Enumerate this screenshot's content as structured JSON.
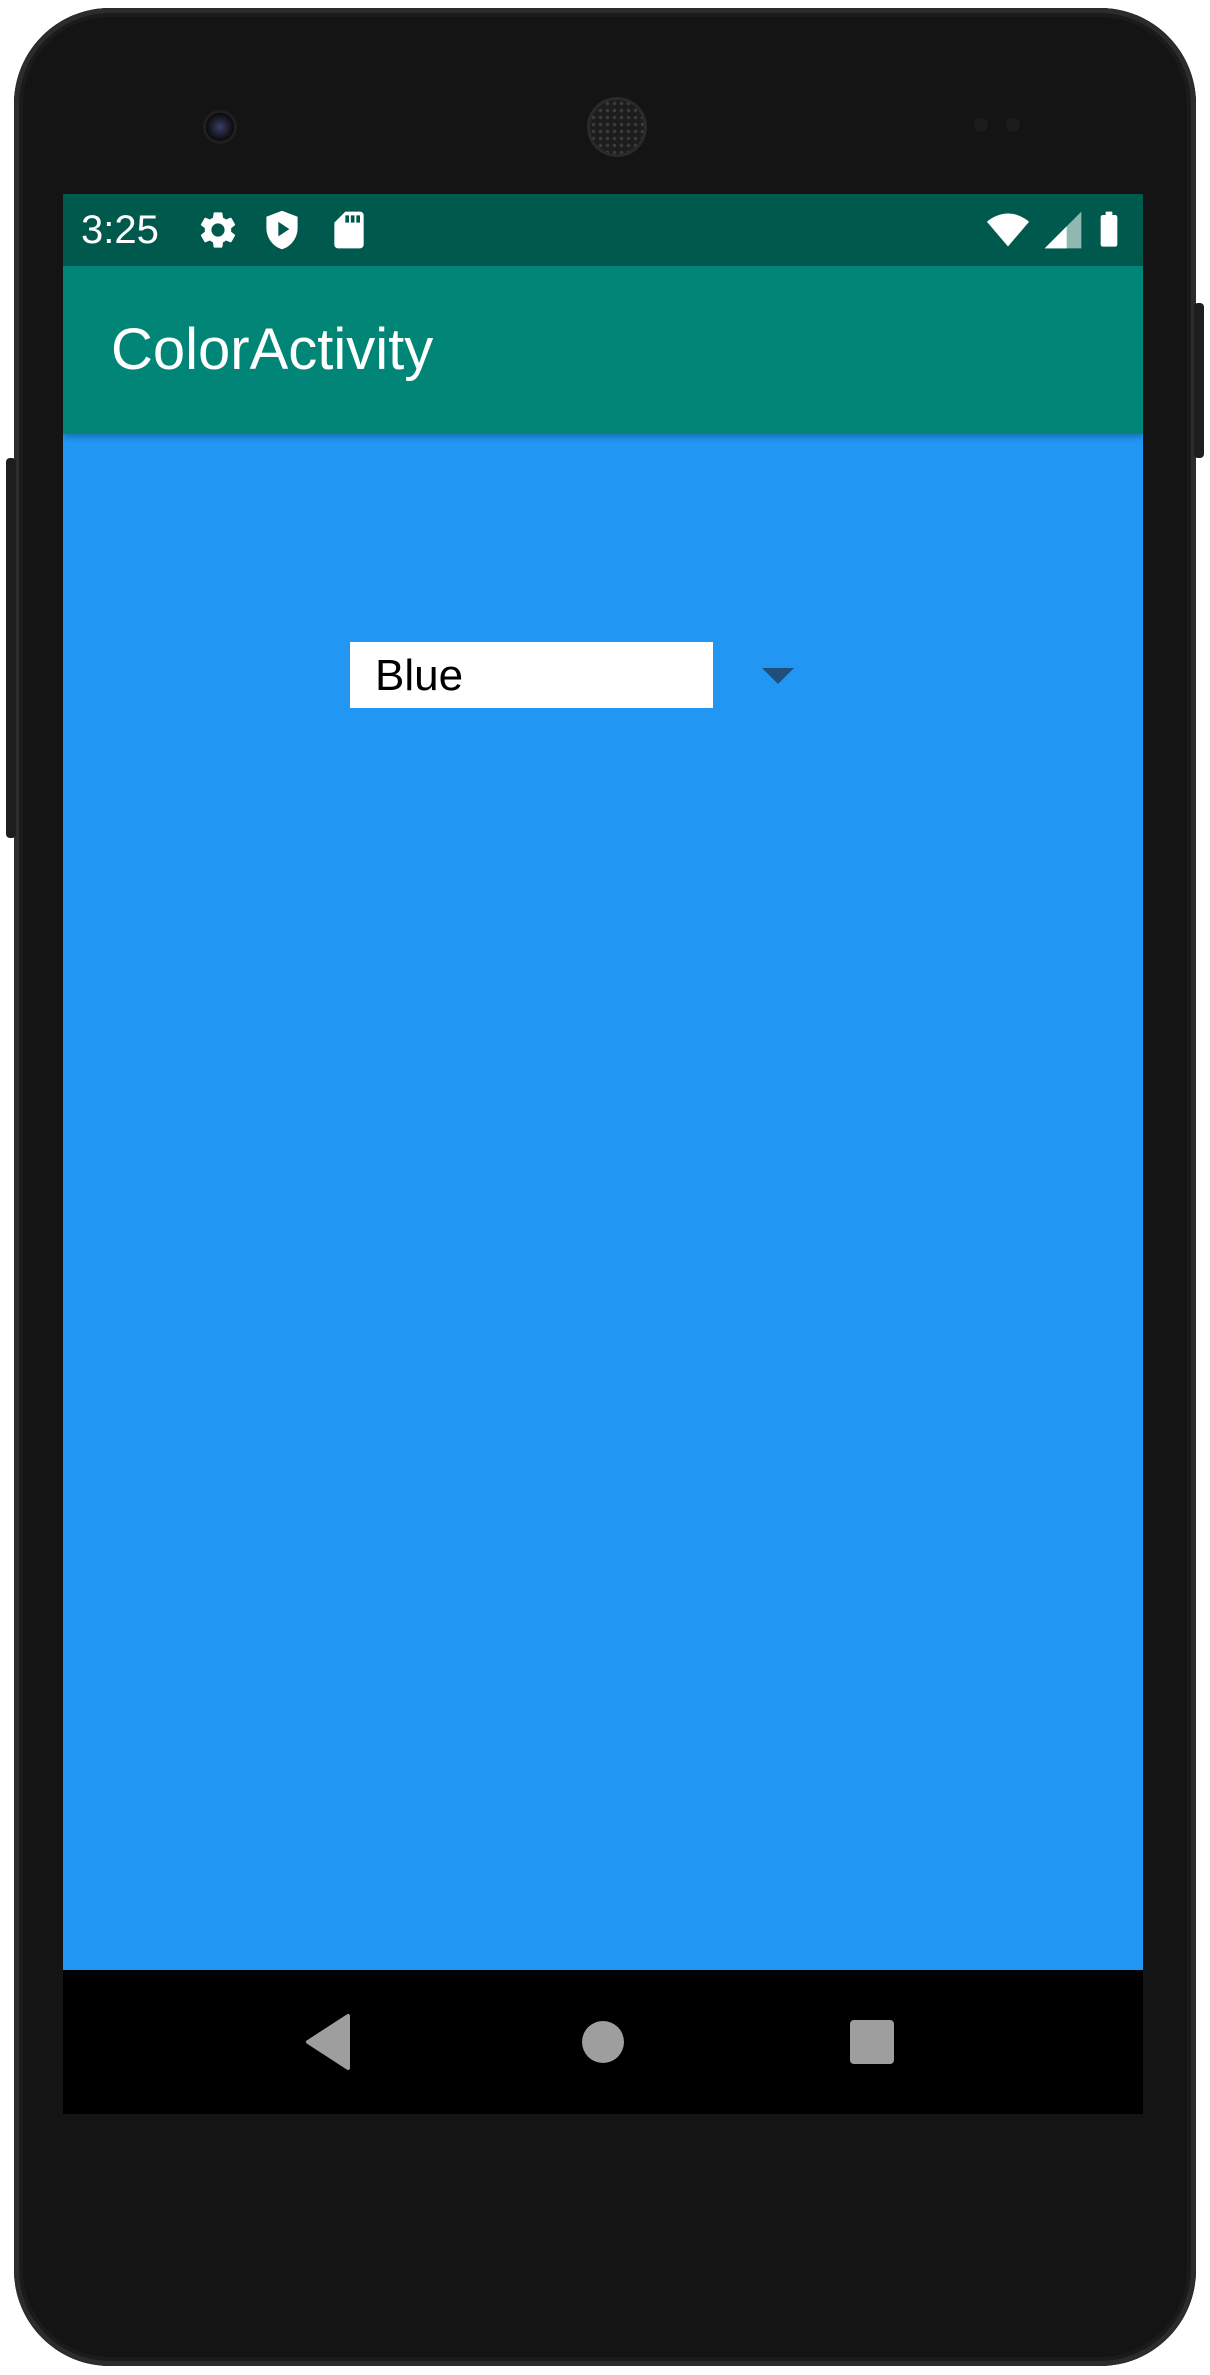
{
  "status_bar": {
    "time": "3:25",
    "left_icons": [
      "settings-icon",
      "play-protect-icon",
      "sd-card-icon"
    ],
    "right_icons": [
      "wifi-icon",
      "signal-icon",
      "battery-icon"
    ]
  },
  "app_bar": {
    "title": "ColorActivity"
  },
  "spinner": {
    "selected": "Blue",
    "arrow_icon": "dropdown-arrow-icon"
  },
  "nav_bar": {
    "icons": [
      "back-icon",
      "home-icon",
      "recents-icon"
    ]
  },
  "colors": {
    "status_bar": "#00594d",
    "app_bar": "#008577",
    "background": "#2196f3",
    "spinner_field": "#ffffff",
    "spinner_arrow": "#1f4f7a",
    "nav_bar": "#000000",
    "nav_icons": "#9e9e9e"
  }
}
